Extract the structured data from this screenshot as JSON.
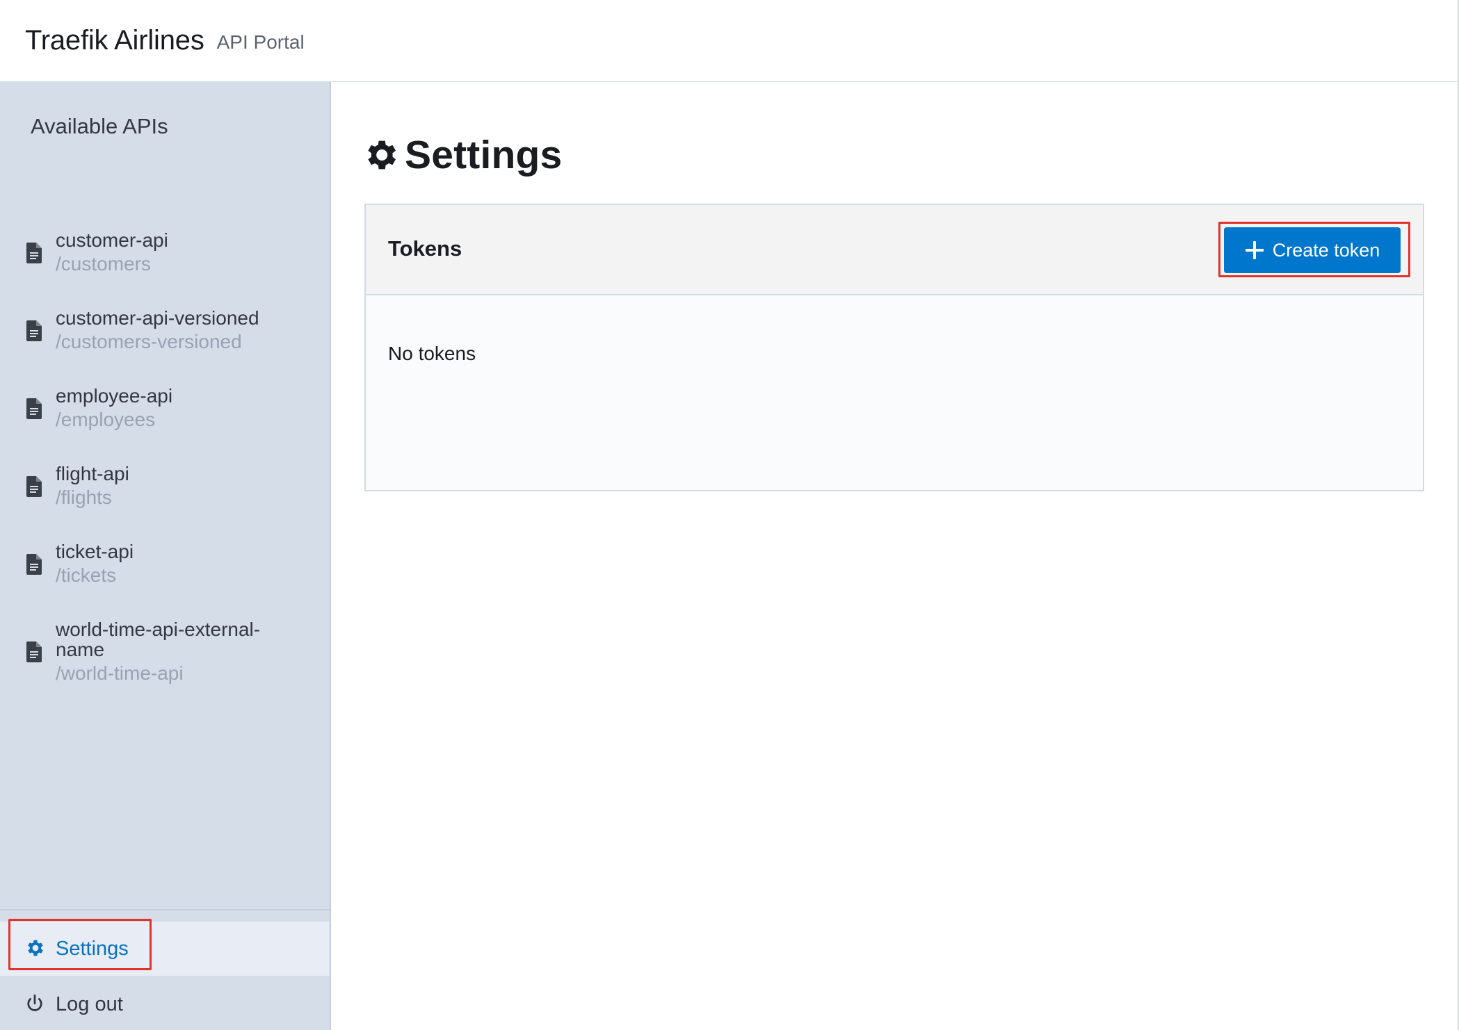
{
  "header": {
    "brand": "Traefik Airlines",
    "subtitle": "API Portal"
  },
  "sidebar": {
    "title": "Available APIs",
    "apis": [
      {
        "name": "customer-api",
        "path": "/customers",
        "icon": "document-icon"
      },
      {
        "name": "customer-api-versioned",
        "path": "/customers-versioned",
        "icon": "document-icon"
      },
      {
        "name": "employee-api",
        "path": "/employees",
        "icon": "document-icon"
      },
      {
        "name": "flight-api",
        "path": "/flights",
        "icon": "document-icon"
      },
      {
        "name": "ticket-api",
        "path": "/tickets",
        "icon": "document-icon"
      },
      {
        "name": "world-time-api-external-name",
        "path": "/world-time-api",
        "icon": "document-icon"
      }
    ],
    "footer": {
      "settings_label": "Settings",
      "settings_icon": "gear-icon",
      "logout_label": "Log out",
      "logout_icon": "power-icon"
    }
  },
  "main": {
    "title": "Settings",
    "title_icon": "gear-icon",
    "tokens_panel": {
      "title": "Tokens",
      "create_button_label": "Create token",
      "create_button_icon": "plus-icon",
      "empty_text": "No tokens"
    }
  },
  "colors": {
    "accent": "#0077cc",
    "sidebar_bg": "#d5dde9",
    "active_nav_bg": "#e8ecf4",
    "active_nav_text": "#0a72c0",
    "highlight": "#e0342b"
  }
}
